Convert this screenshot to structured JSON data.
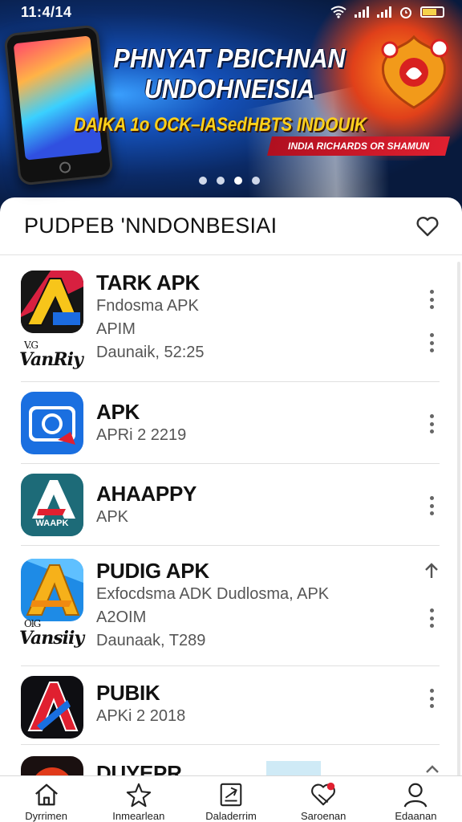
{
  "status": {
    "time": "11:4/14"
  },
  "banner": {
    "title_line1": "PHNYAT PBICHNAN",
    "title_line2": "UNDOHNEISIA",
    "subtitle": "DAIKA 1o OCK–IASedHBTS INDOUIK",
    "ribbon": "INDIA RICHARDS OR SHAMUN",
    "slide_count": 4,
    "active_slide": 2
  },
  "section": {
    "title": "PUDPEB 'NNDONBESIAI"
  },
  "apps": [
    {
      "name": "TARK APK",
      "lines": [
        "Fndosma APK",
        "APIM",
        "Daunaik, 52:25"
      ],
      "brand": "VanRiy",
      "brand_small": "V.G",
      "icon": "gold-a-dark"
    },
    {
      "name": "APK",
      "lines": [
        "APRi 2 2219"
      ],
      "icon": "blue-camera"
    },
    {
      "name": "AHAAPPY",
      "lines": [
        "APK"
      ],
      "icon": "teal-a",
      "icon_text": "WAAPK"
    },
    {
      "name": "PUDIG APK",
      "lines": [
        "Exfocdsma ADK Dudlosma, APK",
        "A2OIM",
        "Daunaak, T289"
      ],
      "brand": "Vansiiy",
      "brand_small": "OlG",
      "icon": "gold-a-blue"
    },
    {
      "name": "PUBIK",
      "lines": [
        "APKi 2 2018"
      ],
      "icon": "red-a-dark"
    },
    {
      "name": "DUYEPR",
      "lines": [],
      "icon": "red-partial"
    }
  ],
  "nav": [
    {
      "label": "Dyrrimen",
      "icon": "home-icon"
    },
    {
      "label": "Inmearlean",
      "icon": "star-icon"
    },
    {
      "label": "Daladerrim",
      "icon": "download-icon"
    },
    {
      "label": "Saroenan",
      "icon": "favorite-icon"
    },
    {
      "label": "Edaanan",
      "icon": "profile-icon"
    }
  ],
  "colors": {
    "banner_bg": "#0b2a66",
    "accent_yellow": "#ffd11a",
    "accent_red": "#e02030"
  }
}
